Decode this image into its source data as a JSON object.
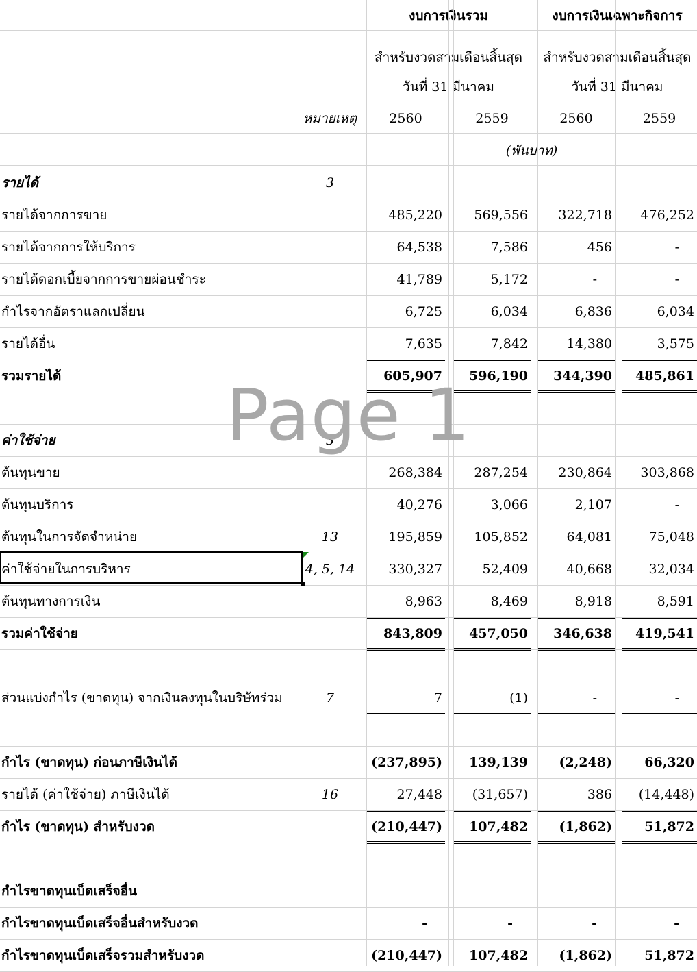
{
  "header": {
    "consolidated_title": "งบการเงินรวม",
    "separate_title": "งบการเงินเฉพาะกิจการ",
    "period_line1": "สำหรับงวดสามเดือนสิ้นสุด",
    "period_line2": "วันที่ 31 มีนาคม",
    "note_label": "หมายเหตุ",
    "years": [
      "2560",
      "2559",
      "2560",
      "2559"
    ],
    "unit": "(พันบาท)"
  },
  "watermark": "Page 1",
  "rows": [
    {
      "label": "รายได้",
      "note": "3",
      "values": [],
      "style": "section"
    },
    {
      "label": "รายได้จากการขาย",
      "note": "",
      "values": [
        "485,220",
        "569,556",
        "322,718",
        "476,252"
      ]
    },
    {
      "label": "รายได้จากการให้บริการ",
      "note": "",
      "values": [
        "64,538",
        "7,586",
        "456",
        "-"
      ]
    },
    {
      "label": "รายได้ดอกเบี้ยจากการขายผ่อนชำระ",
      "note": "",
      "values": [
        "41,789",
        "5,172",
        "-",
        "-"
      ]
    },
    {
      "label": "กำไรจากอัตราแลกเปลี่ยน",
      "note": "",
      "values": [
        "6,725",
        "6,034",
        "6,836",
        "6,034"
      ]
    },
    {
      "label": "รายได้อื่น",
      "note": "",
      "values": [
        "7,635",
        "7,842",
        "14,380",
        "3,575"
      ]
    },
    {
      "label": "รวมรายได้",
      "note": "",
      "values": [
        "605,907",
        "596,190",
        "344,390",
        "485,861"
      ],
      "style": "total"
    },
    {
      "label": "",
      "note": "",
      "values": []
    },
    {
      "label": "ค่าใช้จ่าย",
      "note": "3",
      "values": [],
      "style": "section"
    },
    {
      "label": "ต้นทุนขาย",
      "note": "",
      "values": [
        "268,384",
        "287,254",
        "230,864",
        "303,868"
      ]
    },
    {
      "label": "ต้นทุนบริการ",
      "note": "",
      "values": [
        "40,276",
        "3,066",
        "2,107",
        "-"
      ]
    },
    {
      "label": "ต้นทุนในการจัดจำหน่าย",
      "note": "13",
      "values": [
        "195,859",
        "105,852",
        "64,081",
        "75,048"
      ]
    },
    {
      "label": "ค่าใช้จ่ายในการบริหาร",
      "note": "4, 5, 14",
      "values": [
        "330,327",
        "52,409",
        "40,668",
        "32,034"
      ]
    },
    {
      "label": "ต้นทุนทางการเงิน",
      "note": "",
      "values": [
        "8,963",
        "8,469",
        "8,918",
        "8,591"
      ]
    },
    {
      "label": "รวมค่าใช้จ่าย",
      "note": "",
      "values": [
        "843,809",
        "457,050",
        "346,638",
        "419,541"
      ],
      "style": "total"
    },
    {
      "label": "",
      "note": "",
      "values": []
    },
    {
      "label": "ส่วนแบ่งกำไร (ขาดทุน) จากเงินลงทุนในบริษัทร่วม",
      "note": "7",
      "values": [
        "7",
        "(1)",
        "-",
        "-"
      ]
    },
    {
      "label": "",
      "note": "",
      "values": []
    },
    {
      "label": "กำไร (ขาดทุน) ก่อนภาษีเงินได้",
      "note": "",
      "values": [
        "(237,895)",
        "139,139",
        "(2,248)",
        "66,320"
      ],
      "style": "bold"
    },
    {
      "label": "รายได้ (ค่าใช้จ่าย) ภาษีเงินได้",
      "note": "16",
      "values": [
        "27,448",
        "(31,657)",
        "386",
        "(14,448)"
      ]
    },
    {
      "label": "กำไร (ขาดทุน) สำหรับงวด",
      "note": "",
      "values": [
        "(210,447)",
        "107,482",
        "(1,862)",
        "51,872"
      ],
      "style": "total"
    },
    {
      "label": "",
      "note": "",
      "values": []
    },
    {
      "label": "กำไรขาดทุนเบ็ดเสร็จอื่น",
      "note": "",
      "values": [],
      "style": "bold"
    },
    {
      "label": "กำไรขาดทุนเบ็ดเสร็จอื่นสำหรับงวด",
      "note": "",
      "values": [
        "-",
        "-",
        "-",
        "-"
      ],
      "style": "bold"
    },
    {
      "label": "กำไรขาดทุนเบ็ดเสร็จรวมสำหรับงวด",
      "note": "",
      "values": [
        "(210,447)",
        "107,482",
        "(1,862)",
        "51,872"
      ],
      "style": "bold"
    }
  ]
}
